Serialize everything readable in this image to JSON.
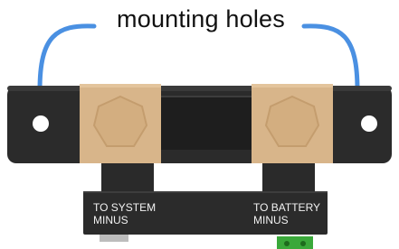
{
  "annotation": {
    "label": "mounting holes",
    "arrow_color": "#4a90e2"
  },
  "shunt": {
    "base_color": "#2b2b2b",
    "block_color": "#d8b58a",
    "terminals": [
      {
        "line1": "TO SYSTEM",
        "line2": "MINUS"
      },
      {
        "line1": "TO BATTERY",
        "line2": "MINUS"
      }
    ],
    "connector_color": "#3aa83a"
  }
}
